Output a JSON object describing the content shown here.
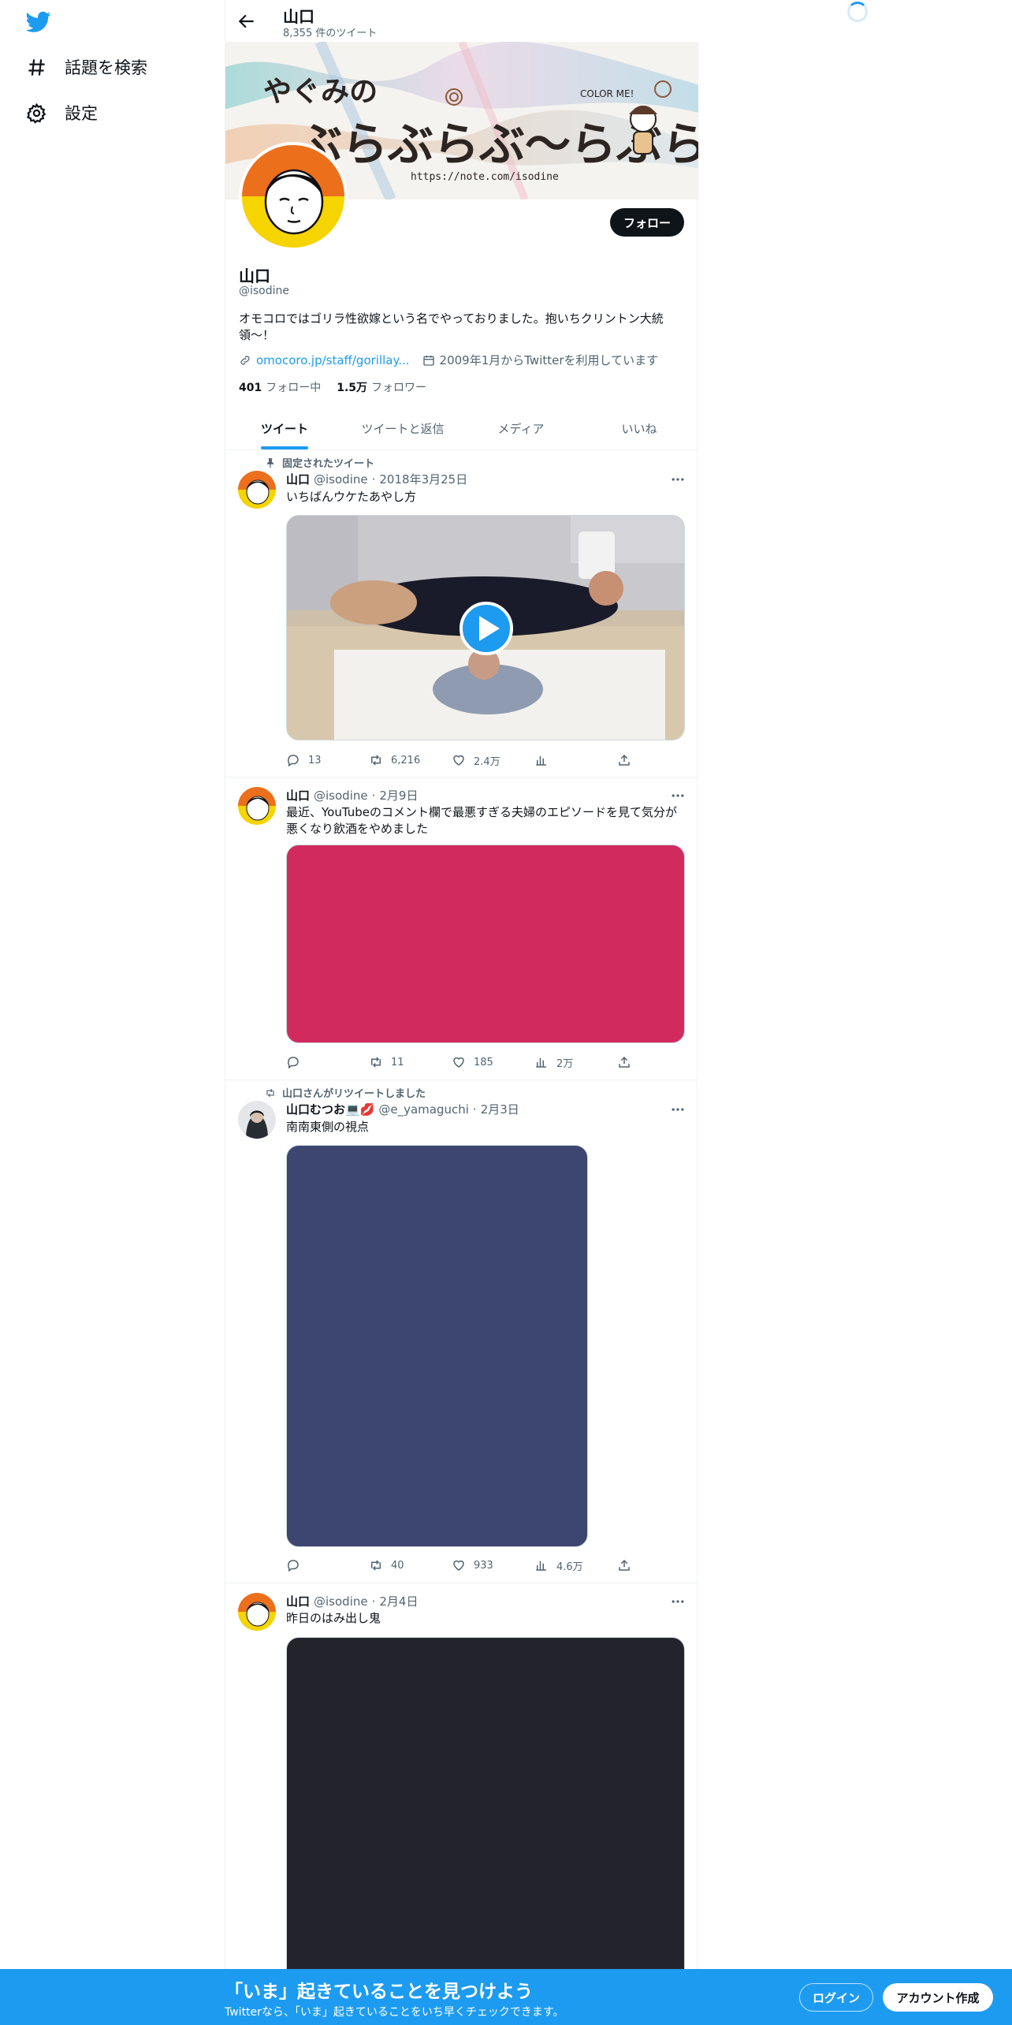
{
  "sidebar": {
    "items": [
      {
        "label": "話題を検索",
        "icon": "hashtag-icon"
      },
      {
        "label": "設定",
        "icon": "gear-icon"
      }
    ]
  },
  "header": {
    "name": "山口",
    "tweet_count": "8,355 件のツイート"
  },
  "profile": {
    "name": "山口",
    "handle": "@isodine",
    "bio": "オモコロではゴリラ性欲嫁という名でやっておりました。抱いちクリントン大統領〜！",
    "link": "omocoro.jp/staff/gorillay...",
    "joined": "2009年1月からTwitterを利用しています",
    "following_count": "401",
    "following_label": "フォロー中",
    "followers_count": "1.5万",
    "followers_label": "フォロワー",
    "follow_button": "フォロー",
    "banner_text": {
      "small_title": "やぐみの",
      "big_title": "ぶらぶらぶ〜らぶら",
      "url": "https://note.com/isodine",
      "tag": "COLOR ME!"
    }
  },
  "tabs": [
    "ツイート",
    "ツイートと返信",
    "メディア",
    "いいね"
  ],
  "tweets": [
    {
      "context": "固定されたツイート",
      "name": "山口",
      "handle": "@isodine",
      "date": "2018年3月25日",
      "text": "いちばんウケたあやし方",
      "replies": "13",
      "retweets": "6,216",
      "likes": "2.4万",
      "views": ""
    },
    {
      "context": "",
      "name": "山口",
      "handle": "@isodine",
      "date": "2月9日",
      "text": "最近、YouTubeのコメント欄で最悪すぎる夫婦のエピソードを見て気分が悪くなり飲酒をやめました",
      "replies": "",
      "retweets": "11",
      "likes": "185",
      "views": "2万",
      "media_color": "#d12a5f"
    },
    {
      "context": "山口さんがリツイートしました",
      "name": "山口むつお💻💋",
      "handle": "@e_yamaguchi",
      "date": "2月3日",
      "text": "南南東側の視点",
      "replies": "",
      "retweets": "40",
      "likes": "933",
      "views": "4.6万",
      "media_color": "#3d4670"
    },
    {
      "context": "",
      "name": "山口",
      "handle": "@isodine",
      "date": "2月4日",
      "text": "昨日のはみ出し鬼",
      "media_color": "#23242b"
    }
  ],
  "bottom_bar": {
    "title": "「いま」起きていることを見つけよう",
    "subtitle": "Twitterなら、「いま」起きていることをいち早くチェックできます。",
    "login": "ログイン",
    "signup": "アカウント作成"
  },
  "colors": {
    "accent": "#1d9bf0",
    "text": "#0f1419",
    "muted": "#536471"
  }
}
